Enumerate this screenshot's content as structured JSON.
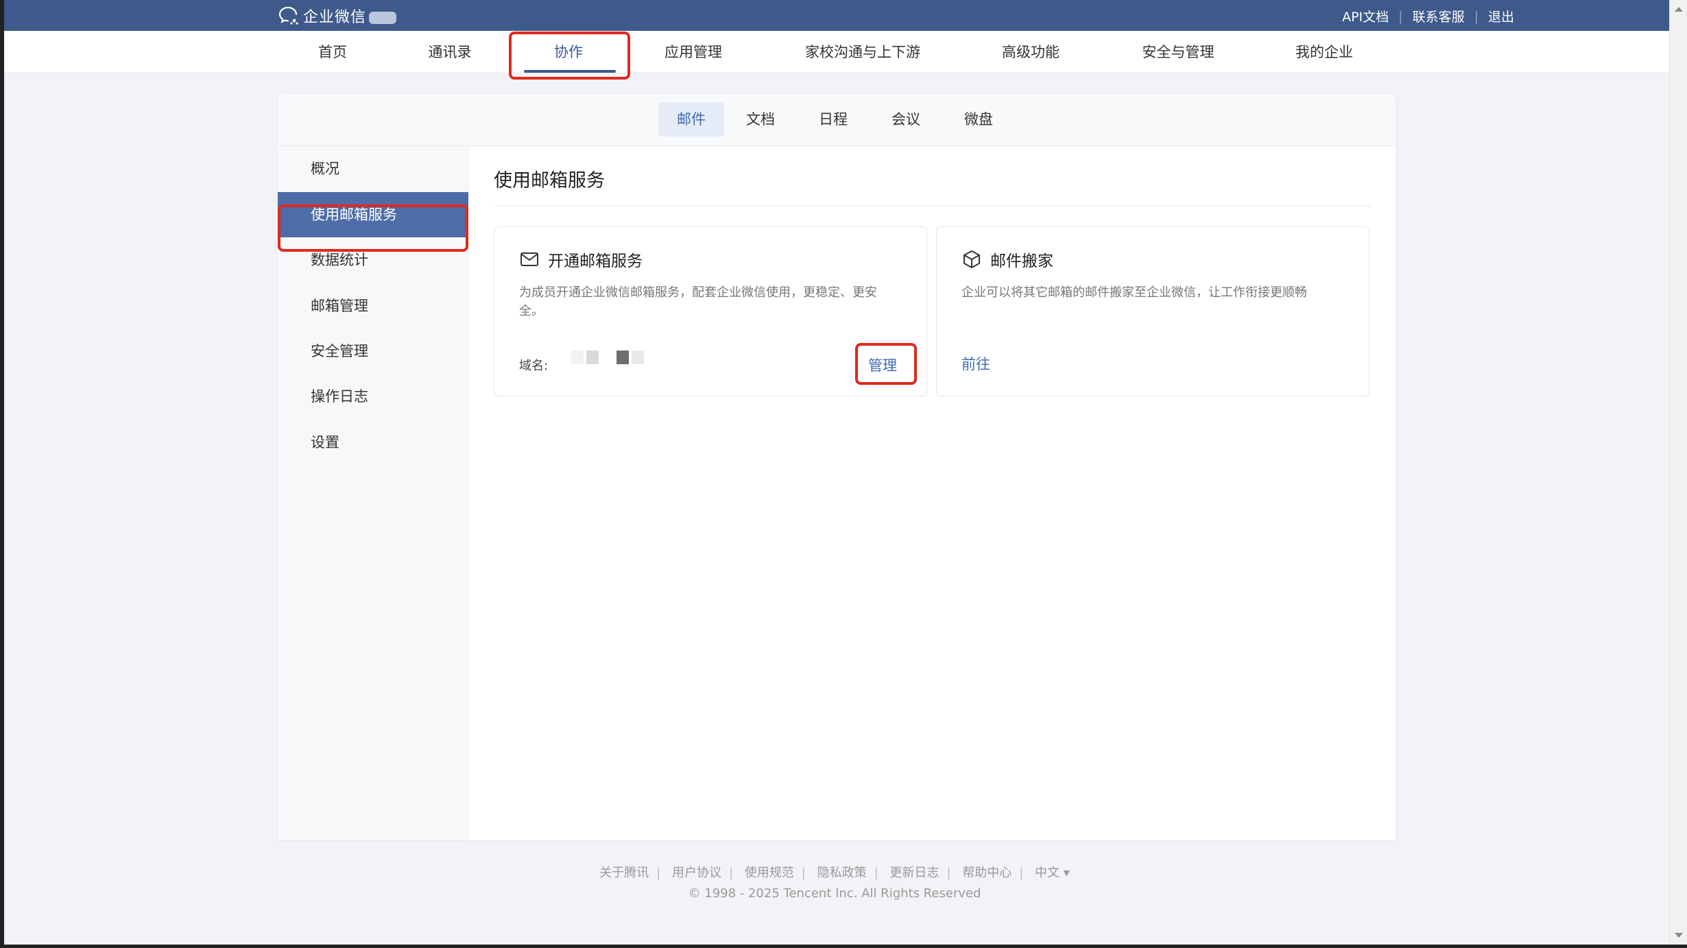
{
  "header": {
    "logo_text": "企业微信",
    "links": [
      "API文档",
      "联系客服",
      "退出"
    ]
  },
  "nav": {
    "items": [
      "首页",
      "通讯录",
      "协作",
      "应用管理",
      "家校沟通与上下游",
      "高级功能",
      "安全与管理",
      "我的企业"
    ],
    "active": "协作"
  },
  "subnav": {
    "items": [
      "邮件",
      "文档",
      "日程",
      "会议",
      "微盘"
    ],
    "active": "邮件"
  },
  "sidebar": {
    "items": [
      "概况",
      "使用邮箱服务",
      "数据统计",
      "邮箱管理",
      "安全管理",
      "操作日志",
      "设置"
    ],
    "active": "使用邮箱服务"
  },
  "main": {
    "title": "使用邮箱服务",
    "cards": [
      {
        "icon": "envelope-icon",
        "title": "开通邮箱服务",
        "desc": "为成员开通企业微信邮箱服务，配套企业微信使用，更稳定、更安全。",
        "domain_label": "域名:",
        "action": "管理"
      },
      {
        "icon": "box-icon",
        "title": "邮件搬家",
        "desc": "企业可以将其它邮箱的邮件搬家至企业微信，让工作衔接更顺畅",
        "action": "前往"
      }
    ]
  },
  "footer": {
    "links": [
      "关于腾讯",
      "用户协议",
      "使用规范",
      "隐私政策",
      "更新日志",
      "帮助中心"
    ],
    "language": "中文 ▾",
    "copyright": "© 1998 - 2025 Tencent Inc. All Rights Reserved"
  },
  "colors": {
    "topbar": "#3d5a8a",
    "accent": "#3d6bb3",
    "sidebar_active": "#4e6da7",
    "highlight": "#e0291c"
  }
}
